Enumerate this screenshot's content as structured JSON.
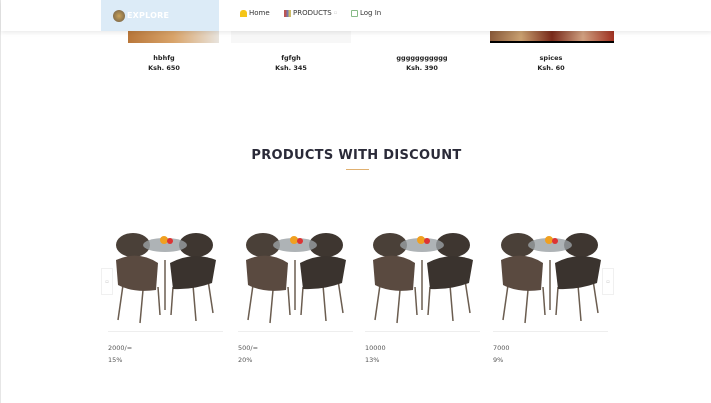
{
  "nav": {
    "brand": "EXPLORE",
    "home": "Home",
    "products": "PRODUCTS",
    "products_caret": "▫",
    "login": "Log In"
  },
  "top_products": [
    {
      "name": "hbhfg",
      "price": "Ksh. 650"
    },
    {
      "name": "fgfgh",
      "price": "Ksh. 345"
    },
    {
      "name": "ggggggggggg",
      "price": "Ksh. 390"
    },
    {
      "name": "spices",
      "price": "Ksh. 60"
    }
  ],
  "discount": {
    "title": "PRODUCTS WITH DISCOUNT",
    "items": [
      {
        "price": "2000/=",
        "discount": "15%"
      },
      {
        "price": "500/=",
        "discount": "20%"
      },
      {
        "price": "10000",
        "discount": "13%"
      },
      {
        "price": "7000",
        "discount": "9%"
      }
    ]
  },
  "carousel": {
    "prev": "▫",
    "next": "▫"
  }
}
